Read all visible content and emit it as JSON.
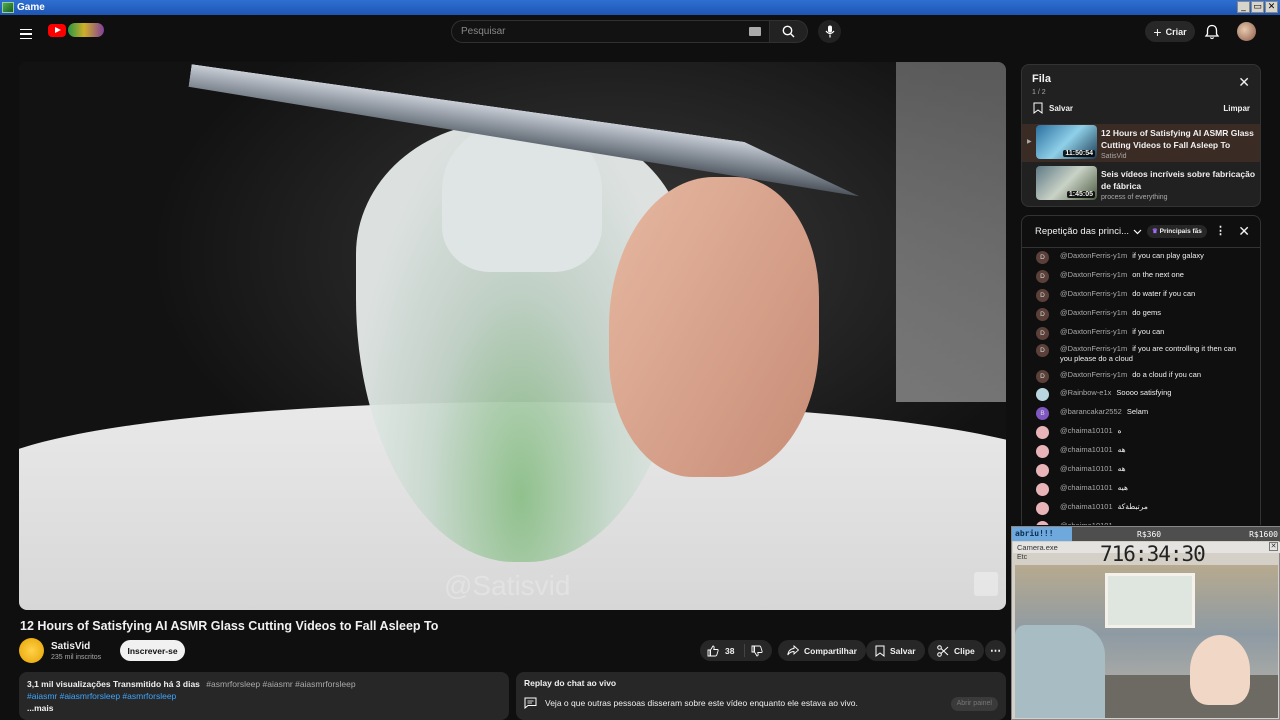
{
  "window": {
    "title": "Game",
    "buttons": [
      "_",
      "▭",
      "✕"
    ]
  },
  "header": {
    "search_placeholder": "Pesquisar",
    "create_label": "Criar"
  },
  "video": {
    "watermark": "@Satisvid",
    "title": "12 Hours of Satisfying AI ASMR Glass Cutting Videos to Fall Asleep To",
    "channel": "SatisVid",
    "subscribers": "235 mil inscritos",
    "subscribe_label": "Inscrever-se",
    "likes": "38",
    "share_label": "Compartilhar",
    "save_label": "Salvar",
    "clip_label": "Clipe"
  },
  "description": {
    "stats": "3,1 mil visualizações  Transmitido há 3 dias",
    "tags_line1": "#asmrforsleep #aiasmr #aiasmrforsleep",
    "tags_line2": "#aiasmr #aiasmrforsleep #asmrforsleep",
    "more": "...mais"
  },
  "replay": {
    "title": "Replay do chat ao vivo",
    "text": "Veja o que outras pessoas disseram sobre este vídeo enquanto ele estava ao vivo.",
    "open_label": "Abrir painel"
  },
  "queue": {
    "title": "Fila",
    "count": "1 / 2",
    "save_label": "Salvar",
    "clear_label": "Limpar",
    "items": [
      {
        "title": "12 Hours of Satisfying AI ASMR Glass Cutting Videos to Fall Asleep To",
        "channel": "SatisVid",
        "duration": "11:50:54"
      },
      {
        "title": "Seis vídeos incríveis sobre fabricação de fábrica",
        "channel": "process of everything",
        "duration": "1:45:05"
      }
    ]
  },
  "chat": {
    "header": "Repetição das princi...",
    "badge": "Principais fãs",
    "messages": [
      {
        "initial": "D",
        "color": "#5a4038",
        "author": "@DaxtonFerris-y1m",
        "text": "if you can play galaxy"
      },
      {
        "initial": "D",
        "color": "#5a4038",
        "author": "@DaxtonFerris-y1m",
        "text": "on the next one"
      },
      {
        "initial": "D",
        "color": "#5a4038",
        "author": "@DaxtonFerris-y1m",
        "text": "do water if you can"
      },
      {
        "initial": "D",
        "color": "#5a4038",
        "author": "@DaxtonFerris-y1m",
        "text": "do gems"
      },
      {
        "initial": "D",
        "color": "#5a4038",
        "author": "@DaxtonFerris-y1m",
        "text": "if you can"
      },
      {
        "initial": "D",
        "color": "#5a4038",
        "author": "@DaxtonFerris-y1m",
        "text": "if you are controlling it then can you please do a cloud"
      },
      {
        "initial": "D",
        "color": "#5a4038",
        "author": "@DaxtonFerris-y1m",
        "text": "do a cloud if you can"
      },
      {
        "initial": "",
        "color": "#b9d6e0",
        "author": "@Rainbow-e1x",
        "text": "Soooo satisfying"
      },
      {
        "initial": "B",
        "color": "#7e57c2",
        "author": "@barancakar2552",
        "text": "Selam"
      },
      {
        "initial": "",
        "color": "#e8b4b8",
        "author": "@chaima10101",
        "text": "ه"
      },
      {
        "initial": "",
        "color": "#e8b4b8",
        "author": "@chaima10101",
        "text": "هه"
      },
      {
        "initial": "",
        "color": "#e8b4b8",
        "author": "@chaima10101",
        "text": "هه"
      },
      {
        "initial": "",
        "color": "#e8b4b8",
        "author": "@chaima10101",
        "text": "هيه"
      },
      {
        "initial": "",
        "color": "#e8b4b8",
        "author": "@chaima10101",
        "text": "مرتبطةكة"
      },
      {
        "initial": "",
        "color": "#e8b4b8",
        "author": "@chaima10101",
        "text": "ه"
      }
    ]
  },
  "overlay": {
    "left_text": "abriu!!!",
    "mid_text": "R$360",
    "right_text": "R$1600",
    "window_title": "Camera.exe",
    "timer": "716:34:30",
    "menu": "Etc"
  }
}
